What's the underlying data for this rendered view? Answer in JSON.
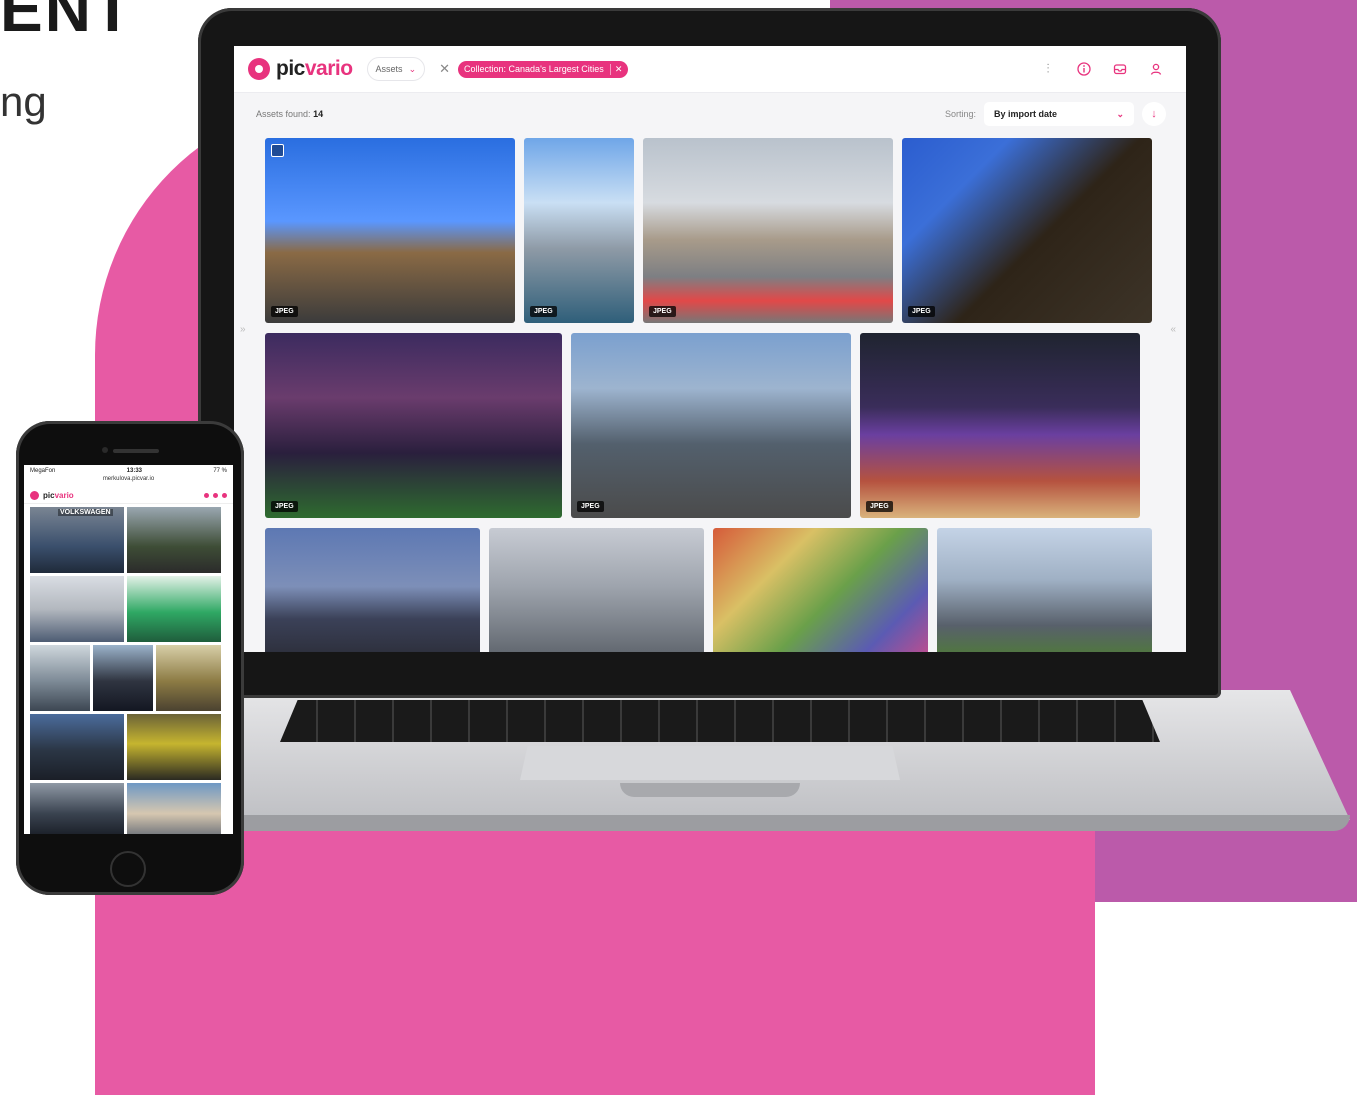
{
  "hero": {
    "headline": "ENT",
    "subline": "ng"
  },
  "app": {
    "logo_prefix": "pic",
    "logo_suffix": "vario",
    "assets_dropdown": "Assets",
    "filter_chip": "Collection: Canada's Largest Cities",
    "assets_found_label": "Assets found:",
    "assets_found_count": "14",
    "sorting_label": "Sorting:",
    "sorting_value": "By import date",
    "left_collapse": "»",
    "right_collapse": "«"
  },
  "thumbnails": [
    {
      "tag": "JPEG"
    },
    {
      "tag": "JPEG"
    },
    {
      "tag": "JPEG"
    },
    {
      "tag": "JPEG"
    },
    {
      "tag": "JPEG"
    },
    {
      "tag": "JPEG"
    },
    {
      "tag": "JPEG"
    },
    {
      "tag": ""
    },
    {
      "tag": ""
    },
    {
      "tag": ""
    },
    {
      "tag": ""
    }
  ],
  "phone": {
    "carrier": "MegaFon",
    "time": "13:33",
    "battery": "77 %",
    "url": "merkulova.picvar.io",
    "logo_prefix": "pic",
    "logo_suffix": "vario",
    "photo_label": "VOLKSWAGEN"
  },
  "icons": {
    "filter": "sliders-icon",
    "info": "info-icon",
    "inbox": "inbox-icon",
    "user": "user-icon",
    "sort_direction": "arrow-down-icon"
  },
  "colors": {
    "brand": "#e8337e",
    "pink_background": "#e75aa4",
    "purple_background": "#bb5aaa"
  }
}
